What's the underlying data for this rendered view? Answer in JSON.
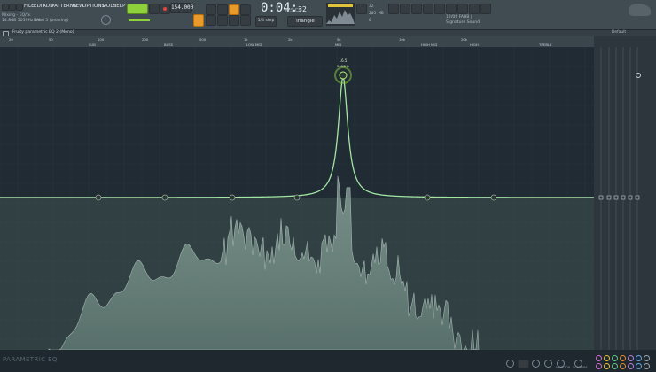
{
  "app": {
    "menu": [
      "FILE",
      "EDIT",
      "ADD",
      "PATTERNS",
      "VIEW",
      "OPTIONS",
      "TOOLS",
      "HELP"
    ],
    "hint_line1": "Mixing - EQ/fx",
    "hint_line2": "14.8dB  5059Hz  0%",
    "hint_line3": "Band 5 (peaking)",
    "tempo": "154.000",
    "time_main": "0:04:",
    "time_sec": "32",
    "time_sub": "M:S:CS",
    "step_label": "1/4 step",
    "pattern_name": "Triangle",
    "cpu": "32",
    "mem": "205 MB",
    "voices": "0",
    "news_line1": "12/06  FABB |",
    "news_line2": "Signature Sound"
  },
  "plugin": {
    "title": "Fruity parametric EQ 2 (Mono)",
    "preset": "Default",
    "freq_labels": [
      {
        "label": "SUB",
        "pos": "100px"
      },
      {
        "label": "BASS",
        "pos": "185px"
      },
      {
        "label": "LOW MID",
        "pos": "278px"
      },
      {
        "label": "MID",
        "pos": "378px"
      },
      {
        "label": "HIGH MID",
        "pos": "475px"
      },
      {
        "label": "HIGH",
        "pos": "530px"
      },
      {
        "label": "TREBLE",
        "pos": "608px"
      }
    ],
    "freq_ticks": [
      "20",
      "50",
      "100",
      "200",
      "500",
      "1k",
      "2k",
      "5k",
      "10k",
      "20k"
    ],
    "peak_value": "16.5",
    "peak_freq": "5059Hz",
    "band_numbers": [
      "1",
      "2",
      "3",
      "4",
      "5",
      "6",
      "7"
    ],
    "brand": "PARAMETRIC EQ",
    "bottom_labels": [
      "MONITOR",
      "COMPARE"
    ]
  },
  "colors": {
    "accent_green": "#8ed13a",
    "accent_orange": "#e89a2a",
    "eq_curve": "#a3e6a4"
  }
}
